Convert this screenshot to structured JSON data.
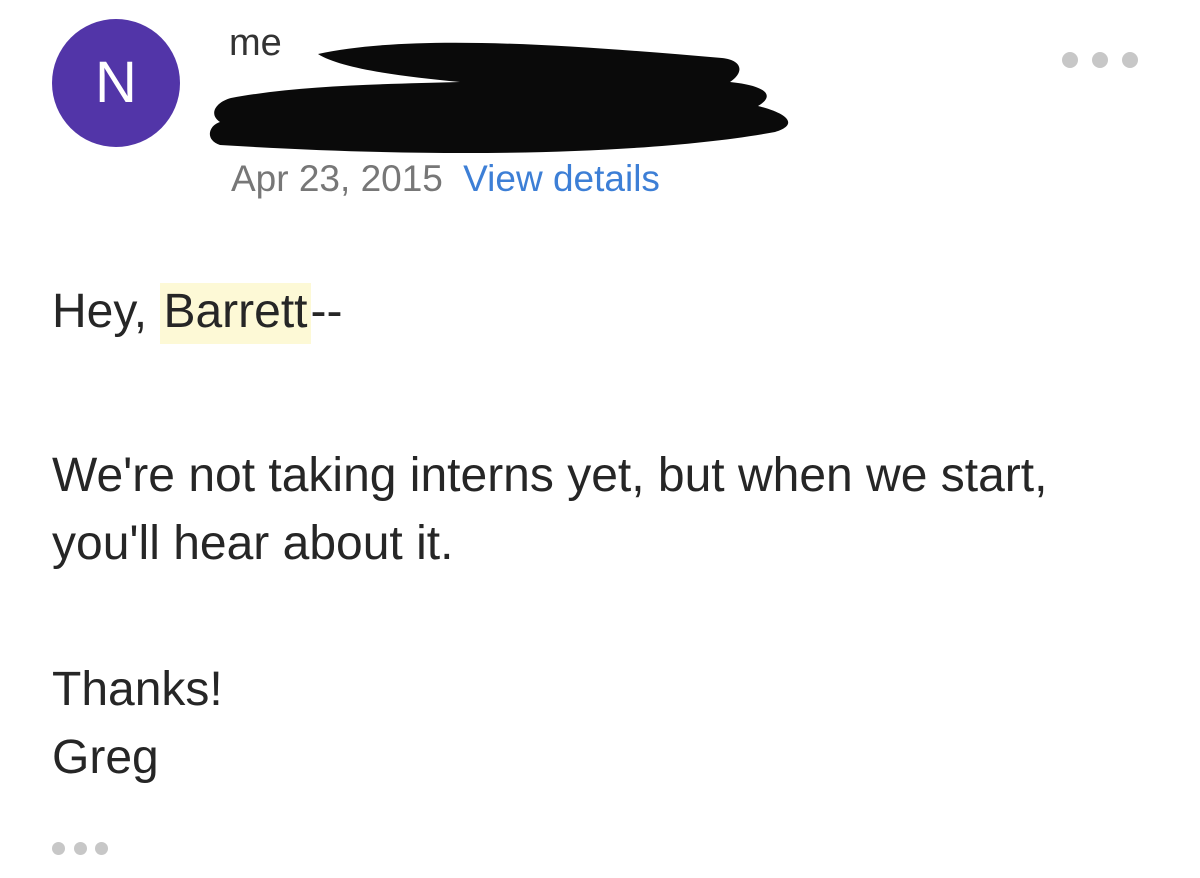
{
  "colors": {
    "avatar_bg": "#5235a8",
    "link": "#3d7fd6",
    "date": "#777777",
    "highlight": "#fdf9d6",
    "redaction": "#0a0a0a"
  },
  "header": {
    "avatar_initial": "N",
    "to_label": "me",
    "date": "Apr 23, 2015",
    "view_details": "View details",
    "more_icon": "more-horizontal-icon"
  },
  "message": {
    "greeting_prefix": "Hey, ",
    "greeting_name": "Barrett",
    "greeting_suffix": "--",
    "paragraph": "We're not taking interns yet, but when we start, you'll hear about it.",
    "closing": "Thanks!",
    "signature": "Greg"
  },
  "footer": {
    "quoted_text_icon": "ellipsis-icon"
  }
}
